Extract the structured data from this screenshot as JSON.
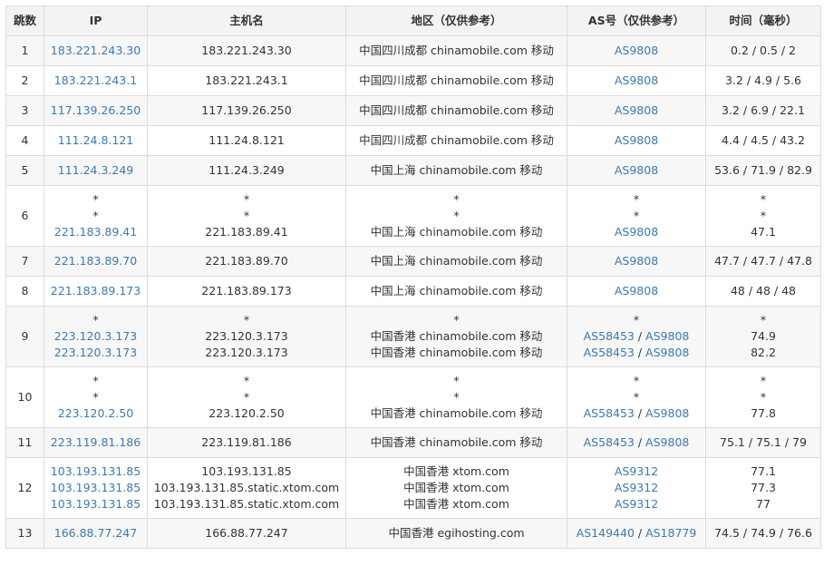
{
  "columns": [
    "跳数",
    "IP",
    "主机名",
    "地区（仅供参考）",
    "AS号（仅供参考）",
    "时间（毫秒）"
  ],
  "rows": [
    {
      "hop": "1",
      "ip": [
        "183.221.243.30"
      ],
      "host": [
        "183.221.243.30"
      ],
      "region": [
        "中国四川成都 chinamobile.com 移动"
      ],
      "as": [
        [
          "AS9808"
        ]
      ],
      "time": [
        "0.2 / 0.5 / 2"
      ]
    },
    {
      "hop": "2",
      "ip": [
        "183.221.243.1"
      ],
      "host": [
        "183.221.243.1"
      ],
      "region": [
        "中国四川成都 chinamobile.com 移动"
      ],
      "as": [
        [
          "AS9808"
        ]
      ],
      "time": [
        "3.2 / 4.9 / 5.6"
      ]
    },
    {
      "hop": "3",
      "ip": [
        "117.139.26.250"
      ],
      "host": [
        "117.139.26.250"
      ],
      "region": [
        "中国四川成都 chinamobile.com 移动"
      ],
      "as": [
        [
          "AS9808"
        ]
      ],
      "time": [
        "3.2 / 6.9 / 22.1"
      ]
    },
    {
      "hop": "4",
      "ip": [
        "111.24.8.121"
      ],
      "host": [
        "111.24.8.121"
      ],
      "region": [
        "中国四川成都 chinamobile.com 移动"
      ],
      "as": [
        [
          "AS9808"
        ]
      ],
      "time": [
        "4.4 / 4.5 / 43.2"
      ]
    },
    {
      "hop": "5",
      "ip": [
        "111.24.3.249"
      ],
      "host": [
        "111.24.3.249"
      ],
      "region": [
        "中国上海 chinamobile.com 移动"
      ],
      "as": [
        [
          "AS9808"
        ]
      ],
      "time": [
        "53.6 / 71.9 / 82.9"
      ]
    },
    {
      "hop": "6",
      "ip": [
        "*",
        "*",
        "221.183.89.41"
      ],
      "host": [
        "*",
        "*",
        "221.183.89.41"
      ],
      "region": [
        "*",
        "*",
        "中国上海 chinamobile.com 移动"
      ],
      "as": [
        [
          "*"
        ],
        [
          "*"
        ],
        [
          "AS9808"
        ]
      ],
      "time": [
        "*",
        "*",
        "47.1"
      ]
    },
    {
      "hop": "7",
      "ip": [
        "221.183.89.70"
      ],
      "host": [
        "221.183.89.70"
      ],
      "region": [
        "中国上海 chinamobile.com 移动"
      ],
      "as": [
        [
          "AS9808"
        ]
      ],
      "time": [
        "47.7 / 47.7 / 47.8"
      ]
    },
    {
      "hop": "8",
      "ip": [
        "221.183.89.173"
      ],
      "host": [
        "221.183.89.173"
      ],
      "region": [
        "中国上海 chinamobile.com 移动"
      ],
      "as": [
        [
          "AS9808"
        ]
      ],
      "time": [
        "48 / 48 / 48"
      ]
    },
    {
      "hop": "9",
      "ip": [
        "*",
        "223.120.3.173",
        "223.120.3.173"
      ],
      "host": [
        "*",
        "223.120.3.173",
        "223.120.3.173"
      ],
      "region": [
        "*",
        "中国香港 chinamobile.com 移动",
        "中国香港 chinamobile.com 移动"
      ],
      "as": [
        [
          "*"
        ],
        [
          "AS58453",
          "AS9808"
        ],
        [
          "AS58453",
          "AS9808"
        ]
      ],
      "time": [
        "*",
        "74.9",
        "82.2"
      ]
    },
    {
      "hop": "10",
      "ip": [
        "*",
        "*",
        "223.120.2.50"
      ],
      "host": [
        "*",
        "*",
        "223.120.2.50"
      ],
      "region": [
        "*",
        "*",
        "中国香港 chinamobile.com 移动"
      ],
      "as": [
        [
          "*"
        ],
        [
          "*"
        ],
        [
          "AS58453",
          "AS9808"
        ]
      ],
      "time": [
        "*",
        "*",
        "77.8"
      ]
    },
    {
      "hop": "11",
      "ip": [
        "223.119.81.186"
      ],
      "host": [
        "223.119.81.186"
      ],
      "region": [
        "中国香港 chinamobile.com 移动"
      ],
      "as": [
        [
          "AS58453",
          "AS9808"
        ]
      ],
      "time": [
        "75.1 / 75.1 / 79"
      ]
    },
    {
      "hop": "12",
      "ip": [
        "103.193.131.85",
        "103.193.131.85",
        "103.193.131.85"
      ],
      "host": [
        "103.193.131.85",
        "103.193.131.85.static.xtom.com",
        "103.193.131.85.static.xtom.com"
      ],
      "region": [
        "中国香港 xtom.com",
        "中国香港 xtom.com",
        "中国香港 xtom.com"
      ],
      "as": [
        [
          "AS9312"
        ],
        [
          "AS9312"
        ],
        [
          "AS9312"
        ]
      ],
      "time": [
        "77.1",
        "77.3",
        "77"
      ]
    },
    {
      "hop": "13",
      "ip": [
        "166.88.77.247"
      ],
      "host": [
        "166.88.77.247"
      ],
      "region": [
        "中国香港 egihosting.com"
      ],
      "as": [
        [
          "AS149440",
          "AS18779"
        ]
      ],
      "time": [
        "74.5 / 74.9 / 76.6"
      ]
    }
  ],
  "as_separator": " / ",
  "colors": {
    "link": "#3c79b4",
    "header_bg": "#f3f3f3",
    "stripe": "#f7f7f7",
    "border": "#dcdcdc"
  }
}
